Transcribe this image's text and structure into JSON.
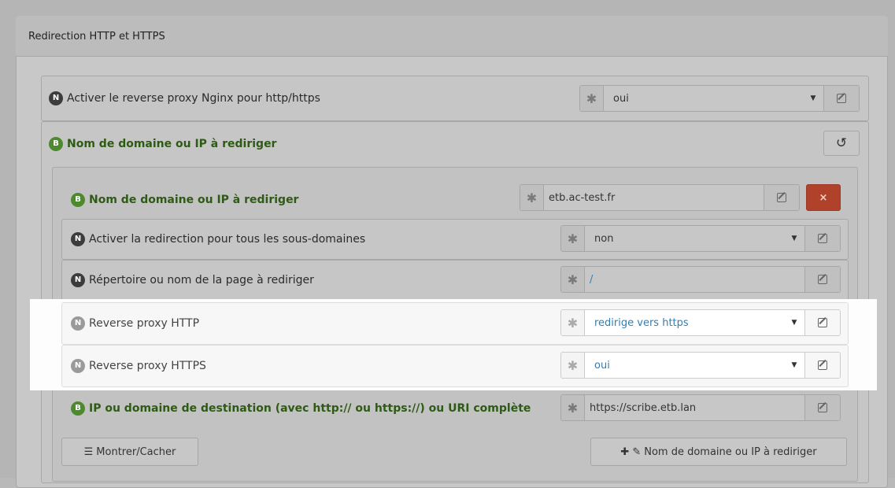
{
  "panel": {
    "title": "Redirection HTTP et HTTPS"
  },
  "rows": {
    "enable_proxy": {
      "badge": "N",
      "label": "Activer le reverse proxy Nginx pour http/https",
      "value": "oui"
    },
    "domain_group": {
      "badge": "B",
      "label": "Nom de domaine ou IP à rediriger",
      "reset_icon": "undo-icon"
    },
    "domain": {
      "badge": "B",
      "label": "Nom de domaine ou IP à rediriger",
      "value": "etb.ac-test.fr",
      "delete_label": "×"
    },
    "subdomains": {
      "badge": "N",
      "label": "Activer la redirection pour tous les sous-domaines",
      "value": "non"
    },
    "page": {
      "badge": "N",
      "label": "Répertoire ou nom de la page à rediriger",
      "value": "/"
    },
    "http": {
      "badge": "N",
      "label": "Reverse proxy HTTP",
      "value": "redirige vers https"
    },
    "https": {
      "badge": "N",
      "label": "Reverse proxy HTTPS",
      "value": "oui"
    },
    "destination": {
      "badge": "B",
      "label": "IP ou domaine de destination (avec http:// ou https://) ou URI complète",
      "value": "https://scribe.etb.lan"
    }
  },
  "footer": {
    "toggle_icon": "☰",
    "toggle_label": "Montrer/Cacher",
    "add_icon": "✚",
    "tag_icon": "✎",
    "add_label": "Nom de domaine ou IP à rediriger"
  },
  "colors": {
    "highlight": "#ffffff",
    "link": "#2d7fb5",
    "delete": "#b0412b",
    "badge_b": "#4d8a2f"
  }
}
